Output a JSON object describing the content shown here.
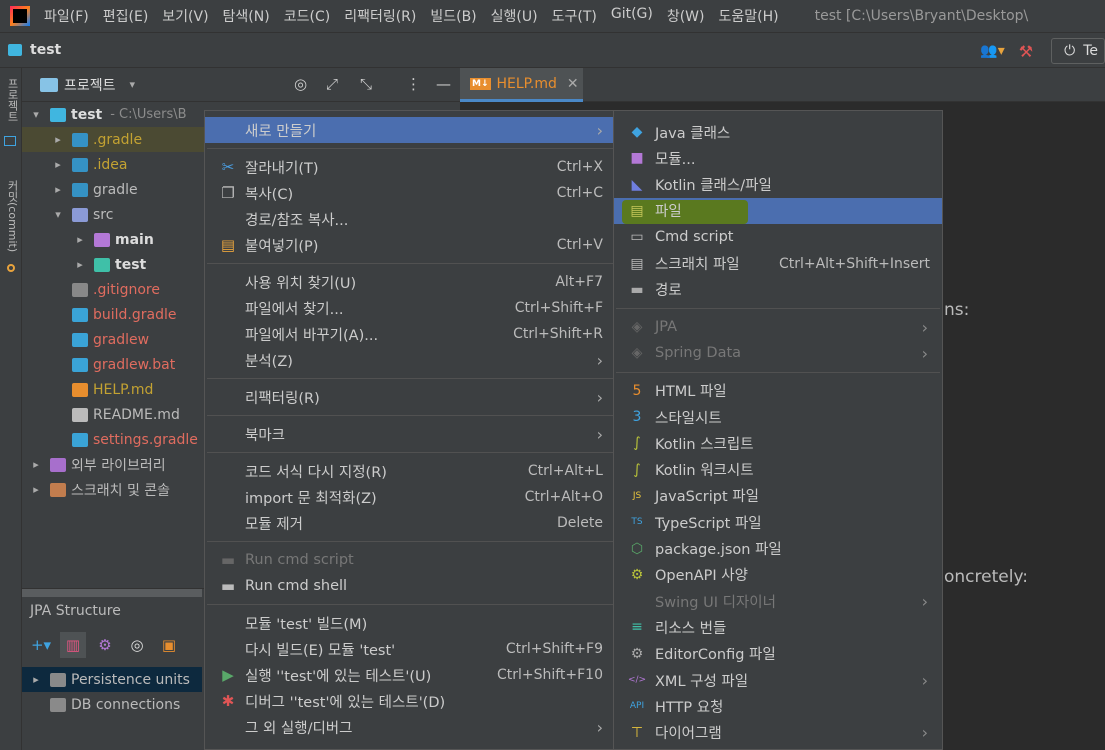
{
  "menubar": {
    "items": [
      "파일(F)",
      "편집(E)",
      "보기(V)",
      "탐색(N)",
      "코드(C)",
      "리팩터링(R)",
      "빌드(B)",
      "실행(U)",
      "도구(T)",
      "Git(G)",
      "창(W)",
      "도움말(H)"
    ],
    "window_title": "test [C:\\Users\\Bryant\\Desktop\\"
  },
  "navbar": {
    "project_name": "test",
    "run_config_label": "Te"
  },
  "left_strip": {
    "tab_project": "프로젝트",
    "tab_commit": "커밋(commit)"
  },
  "project_panel": {
    "title": "프로젝트",
    "tree": [
      {
        "name": "test",
        "path": "- C:\\Users\\B",
        "arrow": "▾",
        "indent": 0,
        "color": "#dddddd",
        "bold": true,
        "icon": "module-folder-icon",
        "icon_color": "#40b6e0"
      },
      {
        "name": ".gradle",
        "arrow": "▸",
        "indent": 1,
        "color": "#c3a232",
        "icon": "gradle-folder-icon",
        "icon_color": "#3592c4",
        "highlight": true
      },
      {
        "name": ".idea",
        "arrow": "▸",
        "indent": 1,
        "color": "#c3a232",
        "icon": "idea-folder-icon",
        "icon_color": "#3592c4"
      },
      {
        "name": "gradle",
        "arrow": "▸",
        "indent": 1,
        "color": "#bbbbbb",
        "icon": "gradle-folder-icon",
        "icon_color": "#3592c4"
      },
      {
        "name": "src",
        "arrow": "▾",
        "indent": 1,
        "color": "#bbbbbb",
        "icon": "source-folder-icon",
        "icon_color": "#8b9ad6"
      },
      {
        "name": "main",
        "arrow": "▸",
        "indent": 2,
        "color": "#dddddd",
        "bold": true,
        "icon": "main-folder-icon",
        "icon_color": "#b378d6"
      },
      {
        "name": "test",
        "arrow": "▸",
        "indent": 2,
        "color": "#dddddd",
        "bold": true,
        "icon": "test-folder-icon",
        "icon_color": "#3fc0a8"
      },
      {
        "name": ".gitignore",
        "arrow": "",
        "indent": 1,
        "color": "#e06c5f",
        "icon": "gitignore-icon",
        "icon_color": "#888888"
      },
      {
        "name": "build.gradle",
        "arrow": "",
        "indent": 1,
        "color": "#e06c5f",
        "icon": "gradle-file-icon",
        "icon_color": "#3aa3d6"
      },
      {
        "name": "gradlew",
        "arrow": "",
        "indent": 1,
        "color": "#e06c5f",
        "icon": "gradle-file-icon",
        "icon_color": "#3aa3d6"
      },
      {
        "name": "gradlew.bat",
        "arrow": "",
        "indent": 1,
        "color": "#e06c5f",
        "icon": "gradle-file-icon",
        "icon_color": "#3aa3d6"
      },
      {
        "name": "HELP.md",
        "arrow": "",
        "indent": 1,
        "color": "#c3a232",
        "icon": "markdown-icon",
        "icon_color": "#e88e2e"
      },
      {
        "name": "README.md",
        "arrow": "",
        "indent": 1,
        "color": "#bbbbbb",
        "icon": "readme-icon",
        "icon_color": "#bbbbbb"
      },
      {
        "name": "settings.gradle",
        "arrow": "",
        "indent": 1,
        "color": "#e06c5f",
        "icon": "gradle-file-icon",
        "icon_color": "#3aa3d6"
      },
      {
        "name": "외부 라이브러리",
        "arrow": "▸",
        "indent": 0,
        "color": "#bbbbbb",
        "icon": "library-icon",
        "icon_color": "#a76fcc"
      },
      {
        "name": "스크래치 및 콘솔",
        "arrow": "▸",
        "indent": 0,
        "color": "#bbbbbb",
        "icon": "scratch-icon",
        "icon_color": "#c27d4e"
      }
    ]
  },
  "jpa_panel": {
    "title": "JPA Structure",
    "items": [
      {
        "label": "Persistence units",
        "arrow": "▸"
      },
      {
        "label": "DB connections",
        "arrow": ""
      }
    ]
  },
  "editor": {
    "tab_label": "HELP.md",
    "tab_icon": "M↓",
    "text_fragments": [
      "ns:",
      "oncretely:"
    ]
  },
  "context_menu": {
    "items": [
      {
        "label": "새로 만들기",
        "shortcut": "",
        "submenu": true,
        "selected": true,
        "icon": "",
        "icon_name": "new-icon"
      },
      {
        "separator": true
      },
      {
        "label": "잘라내기(T)",
        "shortcut": "Ctrl+X",
        "icon": "✂",
        "icon_name": "cut-icon",
        "icon_color": "#4a9de0"
      },
      {
        "label": "복사(C)",
        "shortcut": "Ctrl+C",
        "icon": "❐",
        "icon_name": "copy-icon",
        "icon_color": "#bbbbbb"
      },
      {
        "label": "경로/참조 복사...",
        "shortcut": "",
        "icon": "",
        "icon_name": "copy-path-icon"
      },
      {
        "label": "붙여넣기(P)",
        "shortcut": "Ctrl+V",
        "icon": "▤",
        "icon_name": "paste-icon",
        "icon_color": "#e8a33d"
      },
      {
        "separator": true
      },
      {
        "label": "사용 위치 찾기(U)",
        "shortcut": "Alt+F7",
        "icon": "",
        "icon_name": "find-usages-icon"
      },
      {
        "label": "파일에서 찾기...",
        "shortcut": "Ctrl+Shift+F",
        "icon": "",
        "icon_name": "find-in-files-icon"
      },
      {
        "label": "파일에서 바꾸기(A)...",
        "shortcut": "Ctrl+Shift+R",
        "icon": "",
        "icon_name": "replace-in-files-icon"
      },
      {
        "label": "분석(Z)",
        "shortcut": "",
        "submenu": true,
        "icon": "",
        "icon_name": "analyze-icon"
      },
      {
        "separator": true
      },
      {
        "label": "리팩터링(R)",
        "shortcut": "",
        "submenu": true,
        "icon": "",
        "icon_name": "refactor-icon"
      },
      {
        "separator": true
      },
      {
        "label": "북마크",
        "shortcut": "",
        "submenu": true,
        "icon": "",
        "icon_name": "bookmark-icon"
      },
      {
        "separator": true
      },
      {
        "label": "코드 서식 다시 지정(R)",
        "shortcut": "Ctrl+Alt+L",
        "icon": "",
        "icon_name": "reformat-icon"
      },
      {
        "label": "import 문 최적화(Z)",
        "shortcut": "Ctrl+Alt+O",
        "icon": "",
        "icon_name": "optimize-imports-icon"
      },
      {
        "label": "모듈 제거",
        "shortcut": "Delete",
        "icon": "",
        "icon_name": "remove-module-icon"
      },
      {
        "separator": true
      },
      {
        "label": "Run cmd script",
        "shortcut": "",
        "disabled": true,
        "icon": "▬",
        "icon_name": "cmd-script-icon",
        "icon_color": "#666666"
      },
      {
        "label": "Run cmd shell",
        "shortcut": "",
        "icon": "▬",
        "icon_name": "cmd-shell-icon",
        "icon_color": "#bbbbbb"
      },
      {
        "separator": true
      },
      {
        "label": "모듈 'test' 빌드(M)",
        "shortcut": "",
        "icon": "",
        "icon_name": "build-module-icon"
      },
      {
        "label": "다시 빌드(E) 모듈 'test'",
        "shortcut": "Ctrl+Shift+F9",
        "icon": "",
        "icon_name": "rebuild-icon"
      },
      {
        "label": "실행 ''test'에 있는 테스트'(U)",
        "shortcut": "Ctrl+Shift+F10",
        "icon": "▶",
        "icon_name": "run-icon",
        "icon_color": "#59a869"
      },
      {
        "label": "디버그 ''test'에 있는 테스트'(D)",
        "shortcut": "",
        "icon": "✱",
        "icon_name": "debug-icon",
        "icon_color": "#e05555"
      },
      {
        "label": "그 외 실행/디버그",
        "shortcut": "",
        "submenu": true,
        "icon": "",
        "icon_name": "more-run-icon"
      }
    ]
  },
  "sub_menu": {
    "items": [
      {
        "label": "Java 클래스",
        "icon": "◆",
        "icon_name": "java-class-icon",
        "icon_color": "#3fa3e0"
      },
      {
        "label": "모듈...",
        "icon": "■",
        "icon_name": "module-icon",
        "icon_color": "#b378d6"
      },
      {
        "label": "Kotlin 클래스/파일",
        "icon": "◣",
        "icon_name": "kotlin-icon",
        "icon_color": "#6f7ee0"
      },
      {
        "label": "파일",
        "icon": "▤",
        "icon_name": "file-icon",
        "icon_color": "#c8c85a",
        "selected": true
      },
      {
        "label": "Cmd script",
        "icon": "▭",
        "icon_name": "cmd-icon",
        "icon_color": "#bbbbbb"
      },
      {
        "label": "스크래치 파일",
        "shortcut": "Ctrl+Alt+Shift+Insert",
        "icon": "▤",
        "icon_name": "scratch-file-icon",
        "icon_color": "#bbbbbb"
      },
      {
        "label": "경로",
        "icon": "▬",
        "icon_name": "directory-icon",
        "icon_color": "#aaaaaa"
      },
      {
        "separator": true
      },
      {
        "label": "JPA",
        "disabled": true,
        "submenu": true,
        "icon": "◈",
        "icon_name": "jpa-icon",
        "icon_color": "#666666"
      },
      {
        "label": "Spring Data",
        "disabled": true,
        "submenu": true,
        "icon": "◈",
        "icon_name": "spring-data-icon",
        "icon_color": "#666666"
      },
      {
        "separator": true
      },
      {
        "label": "HTML 파일",
        "icon": "5",
        "icon_name": "html-icon",
        "icon_color": "#e88e2e"
      },
      {
        "label": "스타일시트",
        "icon": "3",
        "icon_name": "css-icon",
        "icon_color": "#3fa3e0"
      },
      {
        "label": "Kotlin 스크립트",
        "icon": "∫",
        "icon_name": "kotlin-script-icon",
        "icon_color": "#b8c23a"
      },
      {
        "label": "Kotlin 워크시트",
        "icon": "∫",
        "icon_name": "kotlin-worksheet-icon",
        "icon_color": "#b8c23a"
      },
      {
        "label": "JavaScript 파일",
        "icon": "JS",
        "icon_name": "javascript-icon",
        "icon_color": "#e8c53d"
      },
      {
        "label": "TypeScript 파일",
        "icon": "TS",
        "icon_name": "typescript-icon",
        "icon_color": "#3fa3e0"
      },
      {
        "label": "package.json 파일",
        "icon": "⬡",
        "icon_name": "package-json-icon",
        "icon_color": "#59a869"
      },
      {
        "label": "OpenAPI 사양",
        "icon": "⚙",
        "icon_name": "openapi-icon",
        "icon_color": "#b8c23a"
      },
      {
        "label": "Swing UI 디자이너",
        "disabled": true,
        "submenu": true,
        "icon": "",
        "icon_name": "swing-designer-icon"
      },
      {
        "label": "리소스 번들",
        "icon": "≡",
        "icon_name": "resource-bundle-icon",
        "icon_color": "#3fc0a8"
      },
      {
        "label": "EditorConfig 파일",
        "icon": "⚙",
        "icon_name": "editorconfig-icon",
        "icon_color": "#aaaaaa"
      },
      {
        "label": "XML 구성 파일",
        "submenu": true,
        "icon": "</>",
        "icon_name": "xml-icon",
        "icon_color": "#b378d6"
      },
      {
        "label": "HTTP 요청",
        "icon": "API",
        "icon_name": "http-request-icon",
        "icon_color": "#3fa3e0"
      },
      {
        "label": "다이어그램",
        "submenu": true,
        "icon": "⊤",
        "icon_name": "diagram-icon",
        "icon_color": "#e8c53d"
      }
    ]
  }
}
